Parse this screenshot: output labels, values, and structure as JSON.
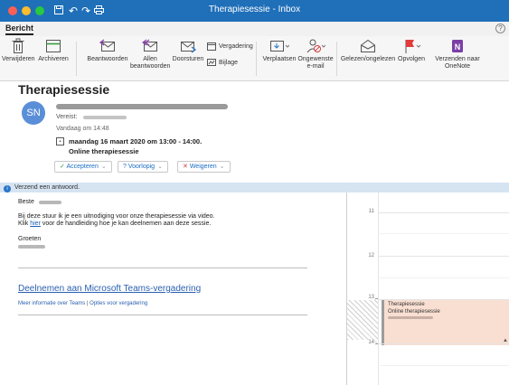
{
  "window": {
    "title": "Therapiesessie - Inbox"
  },
  "tabs": {
    "active": "Bericht"
  },
  "ribbon": {
    "delete": "Verwijderen",
    "archive": "Archiveren",
    "reply": "Beantwoorden",
    "reply_all": "Allen beantwoorden",
    "forward": "Doorsturen",
    "meeting": "Vergadering",
    "attachment": "Bijlage",
    "move": "Verplaatsen",
    "junk": "Ongewenste e-mail",
    "read_unread": "Gelezen/ongelezen",
    "follow_up": "Opvolgen",
    "onenote": "Verzenden naar OneNote"
  },
  "message": {
    "subject": "Therapiesessie",
    "avatar_initials": "SN",
    "required_label": "Vereist:",
    "time": "Vandaag om 14:48",
    "meeting_date": "maandag 16 maart 2020 om 13:00 - 14:00.",
    "meeting_location": "Online therapiesessie",
    "accept": "Accepteren",
    "tentative": "Voorlopig",
    "decline": "Weigeren"
  },
  "infobar": {
    "text": "Verzend een antwoord."
  },
  "body": {
    "greeting": "Beste",
    "line1": "Bij deze stuur ik je een uitnodiging voor onze therapiesessie via video.",
    "line2_pre": "Klik ",
    "line2_link": "hier",
    "line2_post": " voor de handleiding hoe je kan deelnemen aan deze sessie.",
    "closing": "Groeten",
    "teams_link": "Deelnemen aan Microsoft Teams-vergadering",
    "teams_more": "Meer informatie over Teams",
    "teams_sep": " | ",
    "teams_options": "Opties voor vergadering"
  },
  "calendar": {
    "hours": [
      "11",
      "12",
      "13",
      "14"
    ],
    "event_title": "Therapiesessie",
    "event_location": "Online therapiesessie"
  }
}
